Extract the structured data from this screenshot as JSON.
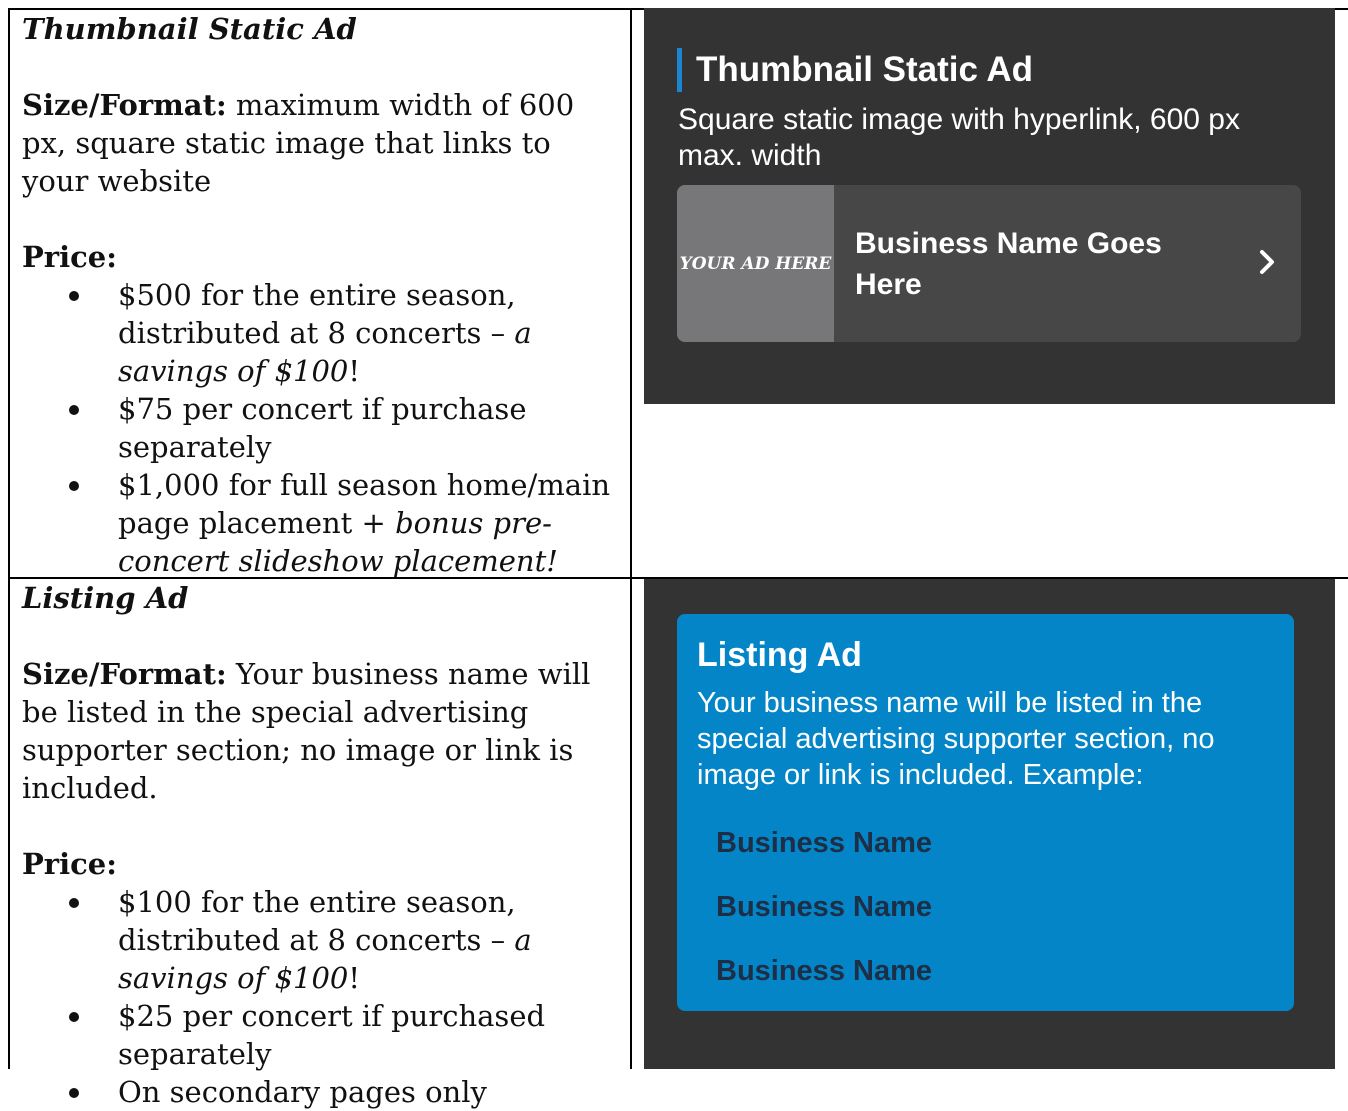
{
  "rows": [
    {
      "left": {
        "title": "Thumbnail Static Ad",
        "size_label": "Size/Format:",
        "size_text": " maximum width of 600 px, square static image that links to your website",
        "price_label": "Price:",
        "bullets": [
          {
            "plain": "$500 for the entire season, distributed at 8 concerts – ",
            "italic": "a savings of $100",
            "tail": "!"
          },
          {
            "plain": "$75 per concert if purchase separately",
            "italic": "",
            "tail": ""
          },
          {
            "plain": "$1,000 for full season home/main page placement + ",
            "italic": "bonus pre-concert slideshow placement!",
            "tail": ""
          }
        ]
      },
      "preview": {
        "title": "Thumbnail Static Ad",
        "description": "Square static image with hyperlink, 600 px max. width",
        "image_placeholder": "YOUR AD HERE",
        "business_name": "Business Name Goes Here",
        "chevron_icon": "chevron-right-icon",
        "accent_color": "#1a86d0"
      }
    },
    {
      "left": {
        "title": "Listing Ad",
        "size_label": "Size/Format:",
        "size_text": " Your business name will be listed in the special advertising supporter section; no image or link is included.",
        "price_label": "Price:",
        "bullets": [
          {
            "plain": "$100 for the entire season, distributed at 8 concerts – ",
            "italic": "a savings of $100",
            "tail": "!"
          },
          {
            "plain": "$25 per concert if purchased separately",
            "italic": "",
            "tail": ""
          },
          {
            "plain": "On secondary pages only",
            "italic": "",
            "tail": ""
          }
        ]
      },
      "preview": {
        "title": "Listing Ad",
        "description": "Your business name will be listed in the special advertising supporter section, no image or link is included. Example:",
        "names": [
          "Business Name",
          "Business Name",
          "Business Name"
        ],
        "box_color": "#0385c8"
      }
    }
  ]
}
